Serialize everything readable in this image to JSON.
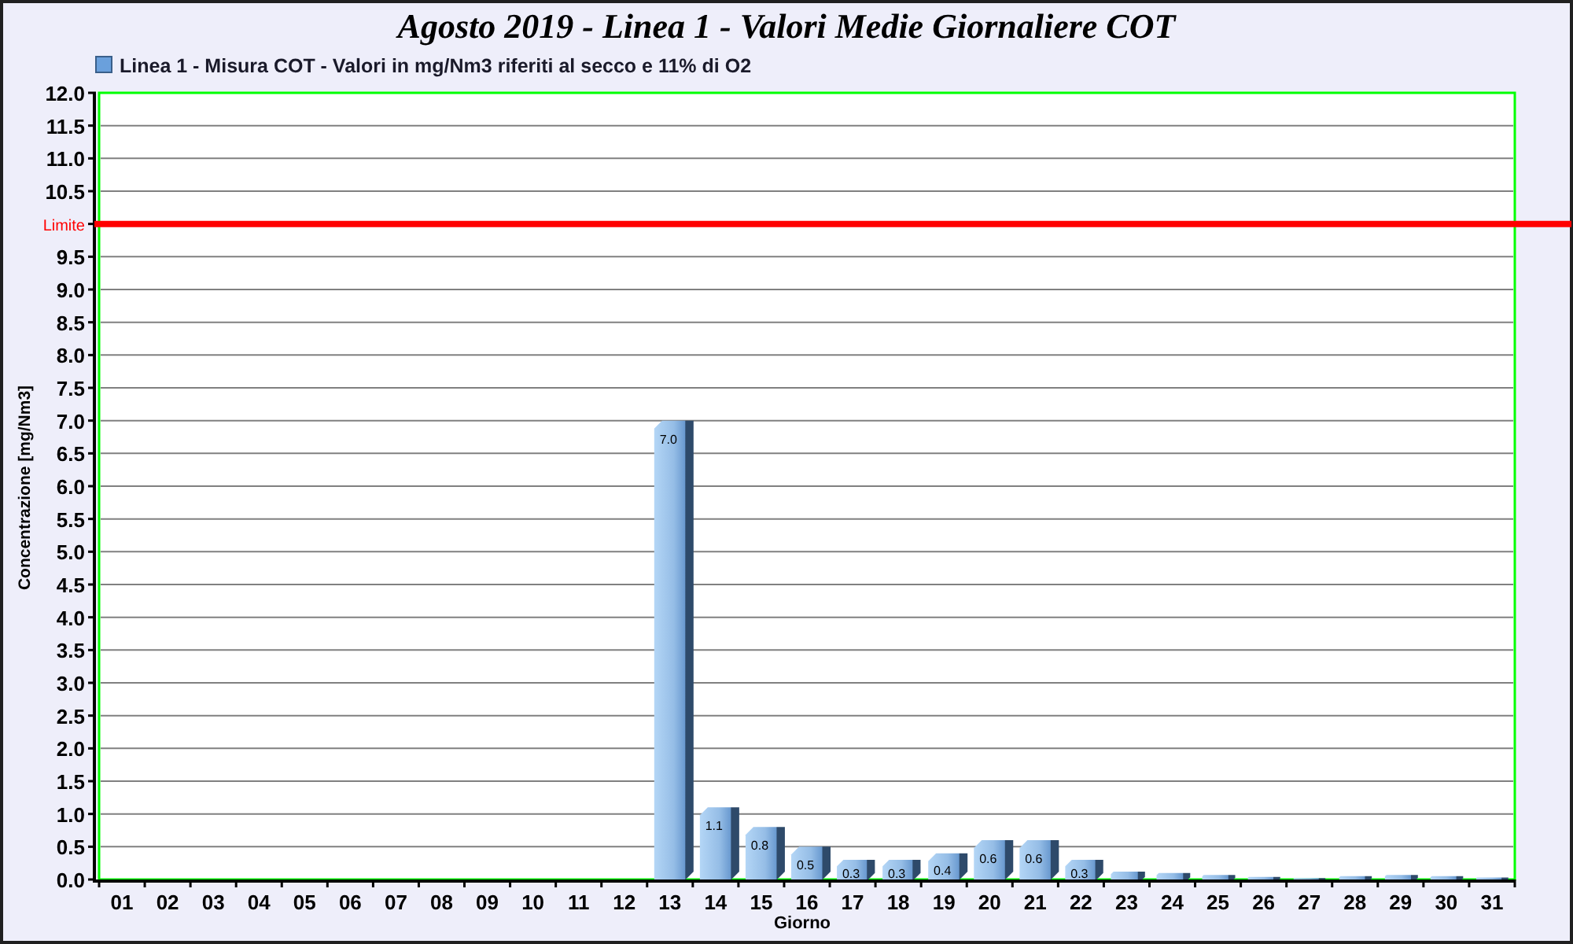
{
  "chart_data": {
    "type": "bar",
    "title": "Agosto 2019 - Linea 1 - Valori Medie Giornaliere COT",
    "xlabel": "Giorno",
    "ylabel": "Concentrazione [mg/Nm3]",
    "categories": [
      "01",
      "02",
      "03",
      "04",
      "05",
      "06",
      "07",
      "08",
      "09",
      "10",
      "11",
      "12",
      "13",
      "14",
      "15",
      "16",
      "17",
      "18",
      "19",
      "20",
      "21",
      "22",
      "23",
      "24",
      "25",
      "26",
      "27",
      "28",
      "29",
      "30",
      "31"
    ],
    "series": [
      {
        "name": "Linea 1 - Misura COT - Valori in mg/Nm3 riferiti al secco e 11% di O2",
        "color": "#6aa0dc",
        "values": [
          0.0,
          0.0,
          0.0,
          0.0,
          0.0,
          0.0,
          0.0,
          0.0,
          0.0,
          0.0,
          0.0,
          0.0,
          7.0,
          1.1,
          0.8,
          0.5,
          0.3,
          0.3,
          0.4,
          0.6,
          0.6,
          0.3,
          0.12,
          0.1,
          0.07,
          0.04,
          0.02,
          0.05,
          0.07,
          0.05,
          0.03
        ]
      }
    ],
    "value_labels": [
      null,
      null,
      null,
      null,
      null,
      null,
      null,
      null,
      null,
      null,
      null,
      null,
      "7.0",
      "1.1",
      "0.8",
      "0.5",
      "0.3",
      "0.3",
      "0.4",
      "0.6",
      "0.6",
      "0.3",
      null,
      null,
      null,
      null,
      null,
      null,
      null,
      null,
      null
    ],
    "ylim": [
      0,
      12
    ],
    "yticks": [
      {
        "value": 0,
        "label": "0.0"
      },
      {
        "value": 0.5,
        "label": "0.5"
      },
      {
        "value": 1,
        "label": "1.0"
      },
      {
        "value": 1.5,
        "label": "1.5"
      },
      {
        "value": 2,
        "label": "2.0"
      },
      {
        "value": 2.5,
        "label": "2.5"
      },
      {
        "value": 3,
        "label": "3.0"
      },
      {
        "value": 3.5,
        "label": "3.5"
      },
      {
        "value": 4,
        "label": "4.0"
      },
      {
        "value": 4.5,
        "label": "4.5"
      },
      {
        "value": 5,
        "label": "5.0"
      },
      {
        "value": 5.5,
        "label": "5.5"
      },
      {
        "value": 6,
        "label": "6.0"
      },
      {
        "value": 6.5,
        "label": "6.5"
      },
      {
        "value": 7,
        "label": "7.0"
      },
      {
        "value": 7.5,
        "label": "7.5"
      },
      {
        "value": 8,
        "label": "8.0"
      },
      {
        "value": 8.5,
        "label": "8.5"
      },
      {
        "value": 9,
        "label": "9.0"
      },
      {
        "value": 9.5,
        "label": "9.5"
      },
      {
        "value": 10.5,
        "label": "10.5"
      },
      {
        "value": 11,
        "label": "11.0"
      },
      {
        "value": 11.5,
        "label": "11.5"
      },
      {
        "value": 12,
        "label": "12.0"
      }
    ],
    "grid": true,
    "ref_lines": [
      {
        "axis": "y",
        "value": 10,
        "label": "Limite",
        "color": "#ff0000"
      }
    ]
  }
}
